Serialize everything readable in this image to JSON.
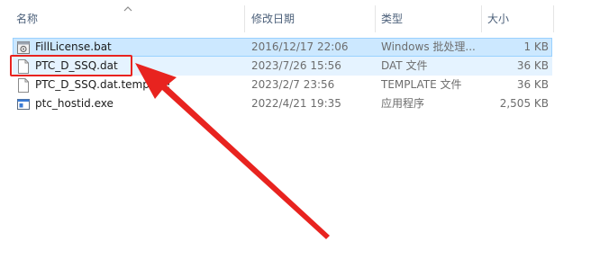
{
  "columns": {
    "name": "名称",
    "modified": "修改日期",
    "type": "类型",
    "size": "大小"
  },
  "files": [
    {
      "name": "FillLicense.bat",
      "modified": "2016/12/17 22:06",
      "type": "Windows 批处理...",
      "size": "1 KB",
      "icon": "batch-file-icon"
    },
    {
      "name": "PTC_D_SSQ.dat",
      "modified": "2023/7/26 15:56",
      "type": "DAT 文件",
      "size": "36 KB",
      "icon": "document-file-icon"
    },
    {
      "name": "PTC_D_SSQ.dat.template",
      "modified": "2023/2/7 23:56",
      "type": "TEMPLATE 文件",
      "size": "36 KB",
      "icon": "document-file-icon"
    },
    {
      "name": "ptc_hostid.exe",
      "modified": "2022/4/21 19:35",
      "type": "应用程序",
      "size": "2,505 KB",
      "icon": "application-exe-icon"
    }
  ],
  "colors": {
    "selected_bg": "#cce8ff",
    "selected_border": "#99d1ff",
    "annotation_red": "#e8231f"
  }
}
